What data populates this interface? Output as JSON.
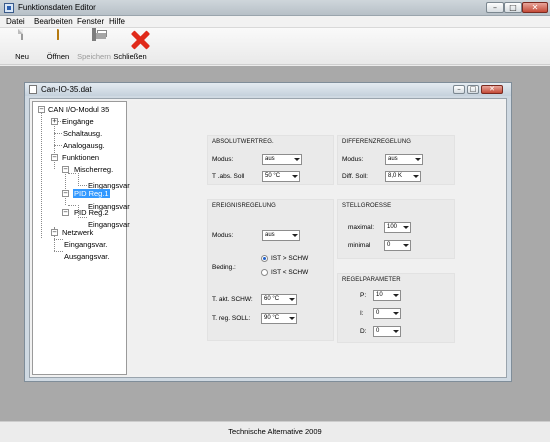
{
  "window": {
    "title": "Funktionsdaten Editor"
  },
  "menu": [
    "Datei",
    "Bearbeiten",
    "Fenster",
    "Hilfe"
  ],
  "toolbar": {
    "new": "Neu",
    "open": "Öffnen",
    "save": "Speichern",
    "close": "Schließen"
  },
  "document": {
    "title": "Can-IO-35.dat"
  },
  "tree": {
    "root": "CAN I/O-Modul 35",
    "inputs": "Eingänge",
    "switch_out": "Schaltausg.",
    "analog_out": "Analogausg.",
    "functions": "Funktionen",
    "mixer": "Mischerreg.",
    "mixer_vars": "Eingangsvar.",
    "pid1": "PID Reg.1",
    "pid1_vars": "Eingangsvar.",
    "pid2": "PID Reg.2",
    "pid2_vars": "Eingangsvar.",
    "network": "Netzwerk",
    "net_in": "Eingangsvar.",
    "net_out": "Ausgangsvar."
  },
  "absolute": {
    "title": "ABSOLUTWERTREG.",
    "mode_label": "Modus:",
    "mode_value": "aus",
    "setpoint_label": "T .abs. Soll",
    "setpoint_value": "50 °C"
  },
  "difference": {
    "title": "DIFFERENZREGELUNG",
    "mode_label": "Modus:",
    "mode_value": "aus",
    "diff_label": "Diff. Soll:",
    "diff_value": "8,0 K"
  },
  "event": {
    "title": "EREIGNISREGELUNG",
    "mode_label": "Modus:",
    "mode_value": "aus",
    "cond_label": "Beding.:",
    "opt1": "IST > SCHW",
    "opt2": "IST < SCHW",
    "tschw_label": "T. akt. SCHW:",
    "tschw_value": "60 °C",
    "tsoll_label": "T. reg. SOLL:",
    "tsoll_value": "90 °C"
  },
  "actuator": {
    "title": "STELLGROESSE",
    "max_label": "maximal:",
    "max_value": "100",
    "min_label": "minimal",
    "min_value": "0"
  },
  "params": {
    "title": "REGELPARAMETER",
    "p_label": "P:",
    "p_value": "10",
    "i_label": "I:",
    "i_value": "0",
    "d_label": "D:",
    "d_value": "0"
  },
  "status": {
    "text": "Technische Alternative 2009"
  }
}
